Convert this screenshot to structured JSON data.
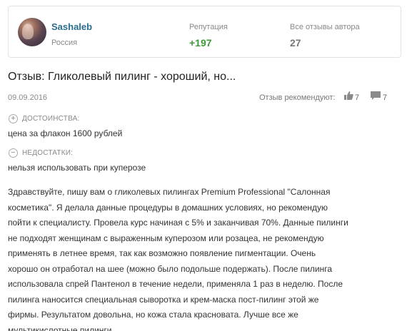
{
  "author": {
    "name": "Sashaleb",
    "country": "Россия",
    "reputation_label": "Репутация",
    "reputation_value": "+197",
    "reviews_label": "Все отзывы автора",
    "reviews_value": "27"
  },
  "review": {
    "title": "Отзыв: Гликолевый пилинг - хороший, но...",
    "date": "09.09.2016",
    "recommend_label": "Отзыв рекомендуют:",
    "likes": "7",
    "comments": "7",
    "pros_label": "ДОСТОИНСТВА:",
    "pros_text": "цена за флакон 1600 рублей",
    "cons_label": "НЕДОСТАТКИ:",
    "cons_text": "нельзя использовать при куперозе",
    "body_lines": [
      "Здравствуйте, пишу вам о гликолевых пилингах Premium Professional \"Салонная",
      "косметика\". Я делала данные процедуры в домашних условиях, но рекомендую",
      "пойти к специалисту. Провела курс начиная с 5% и заканчивая 70%. Данные пилинги",
      "не подходят женщинам с выраженным куперозом или розацеа, не рекомендую",
      "применять в летнее время, так как возможно появление пигментации. Очень",
      "хорошо он отработал на шее (можно было подольше подержать). После пилинга",
      "использовала спрей Пантенол в течение недели, применяла 1 раз в неделю. После",
      "пилинга наносится специальная сыворотка и крем-маска пост-пилинг этой же",
      "фирмы. Результатом довольна, но кожа стала красновата. Лучше все же",
      "мультикислотные пилинги."
    ]
  },
  "icons": {
    "pros": "plus-circle-icon",
    "cons": "minus-circle-icon",
    "like": "thumbs-up-icon",
    "comment": "comment-icon"
  },
  "colors": {
    "author_name": "#2a6f8f",
    "reputation": "#3f9a3a"
  }
}
